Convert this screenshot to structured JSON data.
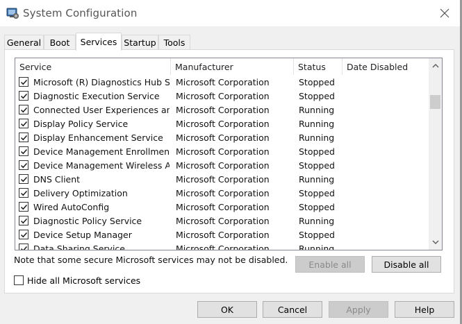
{
  "window": {
    "title": "System Configuration"
  },
  "tabs": [
    {
      "label": "General"
    },
    {
      "label": "Boot"
    },
    {
      "label": "Services",
      "active": true
    },
    {
      "label": "Startup"
    },
    {
      "label": "Tools"
    }
  ],
  "services": {
    "columns": [
      "Service",
      "Manufacturer",
      "Status",
      "Date Disabled"
    ],
    "rows": [
      {
        "checked": true,
        "service": "Microsoft (R) Diagnostics Hub St...",
        "manufacturer": "Microsoft Corporation",
        "status": "Stopped",
        "date_disabled": ""
      },
      {
        "checked": true,
        "service": "Diagnostic Execution Service",
        "manufacturer": "Microsoft Corporation",
        "status": "Stopped",
        "date_disabled": ""
      },
      {
        "checked": true,
        "service": "Connected User Experiences an...",
        "manufacturer": "Microsoft Corporation",
        "status": "Running",
        "date_disabled": ""
      },
      {
        "checked": true,
        "service": "Display Policy Service",
        "manufacturer": "Microsoft Corporation",
        "status": "Running",
        "date_disabled": ""
      },
      {
        "checked": true,
        "service": "Display Enhancement Service",
        "manufacturer": "Microsoft Corporation",
        "status": "Running",
        "date_disabled": ""
      },
      {
        "checked": true,
        "service": "Device Management Enrollment ...",
        "manufacturer": "Microsoft Corporation",
        "status": "Stopped",
        "date_disabled": ""
      },
      {
        "checked": true,
        "service": "Device Management Wireless A...",
        "manufacturer": "Microsoft Corporation",
        "status": "Stopped",
        "date_disabled": ""
      },
      {
        "checked": true,
        "service": "DNS Client",
        "manufacturer": "Microsoft Corporation",
        "status": "Running",
        "date_disabled": ""
      },
      {
        "checked": true,
        "service": "Delivery Optimization",
        "manufacturer": "Microsoft Corporation",
        "status": "Stopped",
        "date_disabled": ""
      },
      {
        "checked": true,
        "service": "Wired AutoConfig",
        "manufacturer": "Microsoft Corporation",
        "status": "Stopped",
        "date_disabled": ""
      },
      {
        "checked": true,
        "service": "Diagnostic Policy Service",
        "manufacturer": "Microsoft Corporation",
        "status": "Running",
        "date_disabled": ""
      },
      {
        "checked": true,
        "service": "Device Setup Manager",
        "manufacturer": "Microsoft Corporation",
        "status": "Stopped",
        "date_disabled": ""
      },
      {
        "checked": true,
        "service": "Data Sharing Service",
        "manufacturer": "Microsoft Corporation",
        "status": "Running",
        "date_disabled": ""
      }
    ]
  },
  "note": "Note that some secure Microsoft services may not be disabled.",
  "buttons": {
    "enable_all": "Enable all",
    "disable_all": "Disable all",
    "ok": "OK",
    "cancel": "Cancel",
    "apply": "Apply",
    "help": "Help"
  },
  "hide_ms": {
    "label": "Hide all Microsoft services",
    "checked": false
  },
  "icons": {
    "app": "system-configuration-icon",
    "close": "close-icon",
    "check": "check-icon",
    "scroll_up": "chevron-up-icon",
    "scroll_down": "chevron-down-icon"
  },
  "colors": {
    "window_bg": "#f0f0f0",
    "panel_bg": "#ffffff",
    "button_bg": "#e1e1e1",
    "disabled_text": "#8a8a8a"
  }
}
